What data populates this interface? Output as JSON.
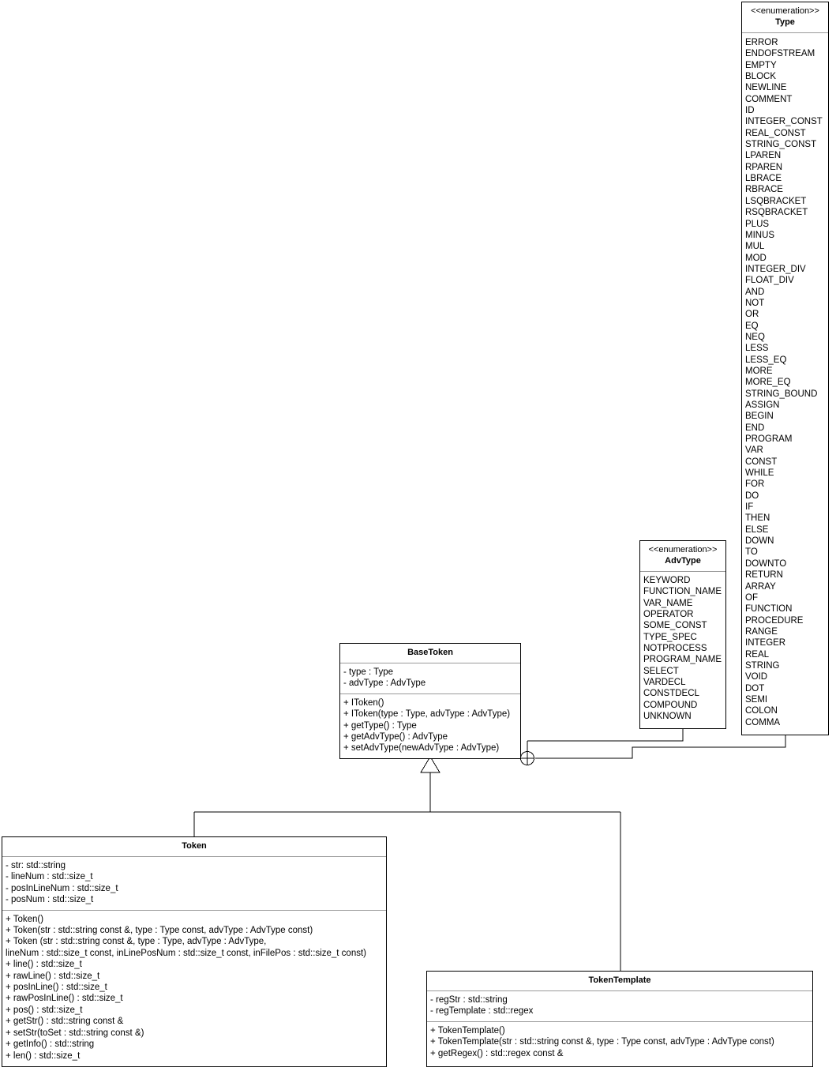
{
  "diagram": {
    "title": "UML class diagram",
    "line_color": "#000000",
    "separator_color": "#9a9a9a",
    "background": "#ffffff"
  },
  "classes": {
    "type_enum": {
      "stereotype": "<<enumeration>>",
      "name": "Type",
      "values": [
        "ERROR",
        "ENDOFSTREAM",
        "EMPTY",
        "BLOCK",
        "NEWLINE",
        "COMMENT",
        "ID",
        "INTEGER_CONST",
        "REAL_CONST",
        "STRING_CONST",
        "LPAREN",
        "RPAREN",
        "LBRACE",
        "RBRACE",
        "LSQBRACKET",
        "RSQBRACKET",
        "PLUS",
        "MINUS",
        "MUL",
        "MOD",
        "INTEGER_DIV",
        "FLOAT_DIV",
        "AND",
        "NOT",
        "OR",
        "EQ",
        "NEQ",
        "LESS",
        "LESS_EQ",
        "MORE",
        "MORE_EQ",
        "STRING_BOUND",
        "ASSIGN",
        "BEGIN",
        "END",
        "PROGRAM",
        "VAR",
        "CONST",
        "WHILE",
        "FOR",
        "DO",
        "IF",
        "THEN",
        "ELSE",
        "DOWN",
        "TO",
        "DOWNTO",
        "RETURN",
        "ARRAY",
        "OF",
        "FUNCTION",
        "PROCEDURE",
        "RANGE",
        "INTEGER",
        "REAL",
        "STRING",
        "VOID",
        "DOT",
        "SEMI",
        "COLON",
        "COMMA"
      ]
    },
    "advtype_enum": {
      "stereotype": "<<enumeration>>",
      "name": "AdvType",
      "values": [
        "KEYWORD",
        "FUNCTION_NAME",
        "VAR_NAME",
        "OPERATOR",
        "SOME_CONST",
        "TYPE_SPEC",
        "NOTPROCESS",
        "PROGRAM_NAME",
        "SELECT",
        "VARDECL",
        "CONSTDECL",
        "COMPOUND",
        "UNKNOWN"
      ]
    },
    "basetoken": {
      "name": "BaseToken",
      "attributes": [
        "- type : Type",
        "- advType : AdvType"
      ],
      "operations": [
        "+ IToken()",
        "+ IToken(type : Type, advType : AdvType)",
        "+ getType() : Type",
        "+ getAdvType() : AdvType",
        "+ setAdvType(newAdvType : AdvType)"
      ]
    },
    "token": {
      "name": "Token",
      "attributes": [
        "- str: std::string",
        "- lineNum : std::size_t",
        "- posInLineNum : std::size_t",
        "- posNum : std::size_t"
      ],
      "operations": [
        "+ Token()",
        "+ Token(str : std::string const &, type : Type const, advType : AdvType const)",
        "+ Token (str : std::string const &, type : Type, advType : AdvType,",
        "lineNum : std::size_t const, inLinePosNum : std::size_t const, inFilePos : std::size_t const)",
        "+ line() : std::size_t",
        "+ rawLine() : std::size_t",
        "+ posInLine() : std::size_t",
        "+ rawPosInLine() : std::size_t",
        "+ pos() : std::size_t",
        "+ getStr() : std::string const &",
        "+ setStr(toSet : std::string const &)",
        "+ getInfo() : std::string",
        "+ len() : std::size_t"
      ]
    },
    "tokentemplate": {
      "name": "TokenTemplate",
      "attributes": [
        "- regStr : std::string",
        "- regTemplate : std::regex"
      ],
      "operations": [
        "+ TokenTemplate()",
        "+ TokenTemplate(str : std::string const &, type : Type const, advType : AdvType const)",
        "+ getRegex() : std::regex const &"
      ]
    }
  },
  "relationships": [
    {
      "name": "generalization-token-basetoken",
      "kind": "generalization",
      "from": "Token",
      "to": "BaseToken",
      "marker": "hollow-triangle"
    },
    {
      "name": "generalization-tokentemplate-basetoken",
      "kind": "generalization",
      "from": "TokenTemplate",
      "to": "BaseToken",
      "marker": "hollow-triangle"
    },
    {
      "name": "dependency-basetoken-type",
      "kind": "dependency",
      "from": "BaseToken",
      "to": "Type",
      "marker": "circle-plus"
    },
    {
      "name": "dependency-basetoken-advtype",
      "kind": "dependency",
      "from": "BaseToken",
      "to": "AdvType",
      "marker": "circle-plus"
    }
  ]
}
